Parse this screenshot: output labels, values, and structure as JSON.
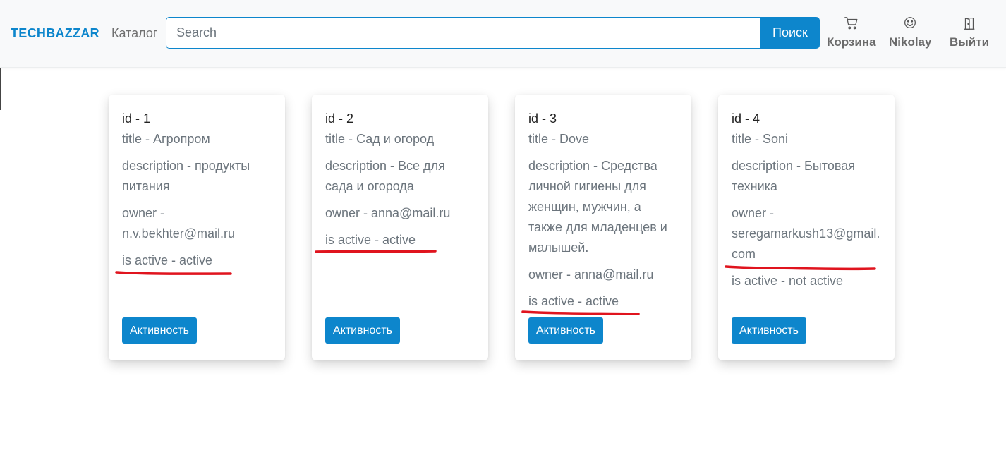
{
  "header": {
    "brand": "TECHBAZZAR",
    "catalog_link": "Каталог",
    "search": {
      "placeholder": "Search",
      "value": ""
    },
    "search_button": "Поиск",
    "cart_label": "Корзина",
    "user_label": "Nikolay",
    "logout_label": "Выйти"
  },
  "cards": [
    {
      "id": "id - 1",
      "title": "title - Агропром",
      "description": "description - продукты питания",
      "owner": "owner - n.v.bekhter@mail.ru",
      "is_active": "is active - active",
      "button": "Активность"
    },
    {
      "id": "id - 2",
      "title": "title - Сад и огород",
      "description": "description - Все для сада и огорода",
      "owner": "owner - anna@mail.ru",
      "is_active": "is active - active",
      "button": "Активность"
    },
    {
      "id": "id - 3",
      "title": "title - Dove",
      "description": "description - Средства личной гигиены для женщин, мужчин, а также для младенцев и малышей.",
      "owner": "owner - anna@mail.ru",
      "is_active": "is active - active",
      "button": "Активность"
    },
    {
      "id": "id - 4",
      "title": "title - Soni",
      "description": "description - Бытовая техника",
      "owner": "owner - seregamarkush13@gmail.com",
      "is_active": "is active - not active",
      "button": "Активность"
    }
  ],
  "colors": {
    "accent": "#0d86cc",
    "navbar_bg": "#f8f9fa",
    "muted_text": "#6c757d",
    "annotation": "#e0141e"
  }
}
